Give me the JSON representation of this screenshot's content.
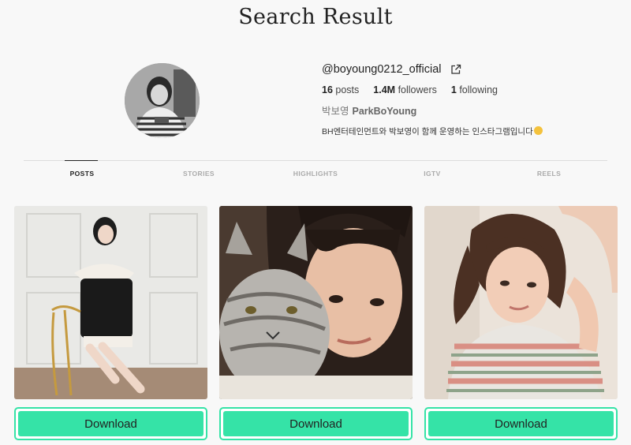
{
  "page": {
    "title": "Search Result"
  },
  "profile": {
    "username": "@boyoung0212_official",
    "posts_count": "16",
    "posts_label": "posts",
    "followers_count": "1.4M",
    "followers_label": "followers",
    "following_count": "1",
    "following_label": "following",
    "korean_name": "박보영",
    "full_name": "ParkBoYoung",
    "bio": "BH엔터테인먼트와 박보영이 함께 운영하는 인스타그램입니다",
    "bio_emoji": "grinning-face-emoji",
    "link_icon": "external-link-icon"
  },
  "tabs": [
    "POSTS",
    "STORIES",
    "HIGHLIGHTS",
    "IGTV",
    "REELS"
  ],
  "active_tab": "POSTS",
  "posts": [
    {
      "photo": "woman-seated-on-gold-chair-in-black-dress",
      "download_label": "Download"
    },
    {
      "photo": "woman-with-grey-tabby-cat-selfie",
      "download_label": "Download"
    },
    {
      "photo": "woman-in-striped-shirt-hand-on-head",
      "download_label": "Download"
    }
  ],
  "colors": {
    "accent": "#35e3a7",
    "background": "#f8f8f8",
    "text": "#222222"
  }
}
